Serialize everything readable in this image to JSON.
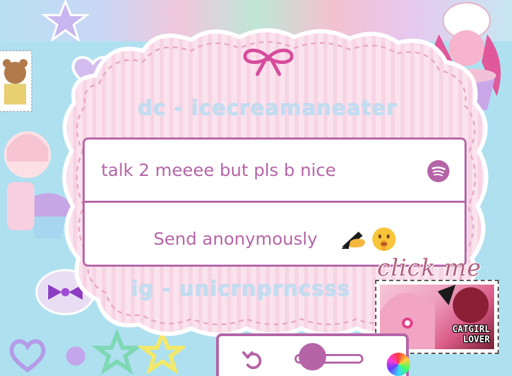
{
  "header": {
    "dc_handle": "dc - icecreamaneater",
    "ig_handle": "ig - unicrnprncsss"
  },
  "card": {
    "prompt": "talk 2 meeee but pls b nice",
    "prompt_icon": "spotify-icon",
    "send_label": "Send anonymously",
    "send_emojis": [
      "writing-hand-emoji",
      "shushing-face-emoji"
    ]
  },
  "sticker": {
    "click_me": "click me",
    "stamp_label": "CATGIRL\nLOVER"
  },
  "toolbar": {
    "undo_icon": "undo-icon",
    "slider_value": 0.1,
    "color_icon": "color-wheel-icon"
  },
  "colors": {
    "accent": "#b565a7",
    "background": "#aee0f0",
    "cloud": "#fbe3ee",
    "handle_text": "#c3dcf0"
  }
}
